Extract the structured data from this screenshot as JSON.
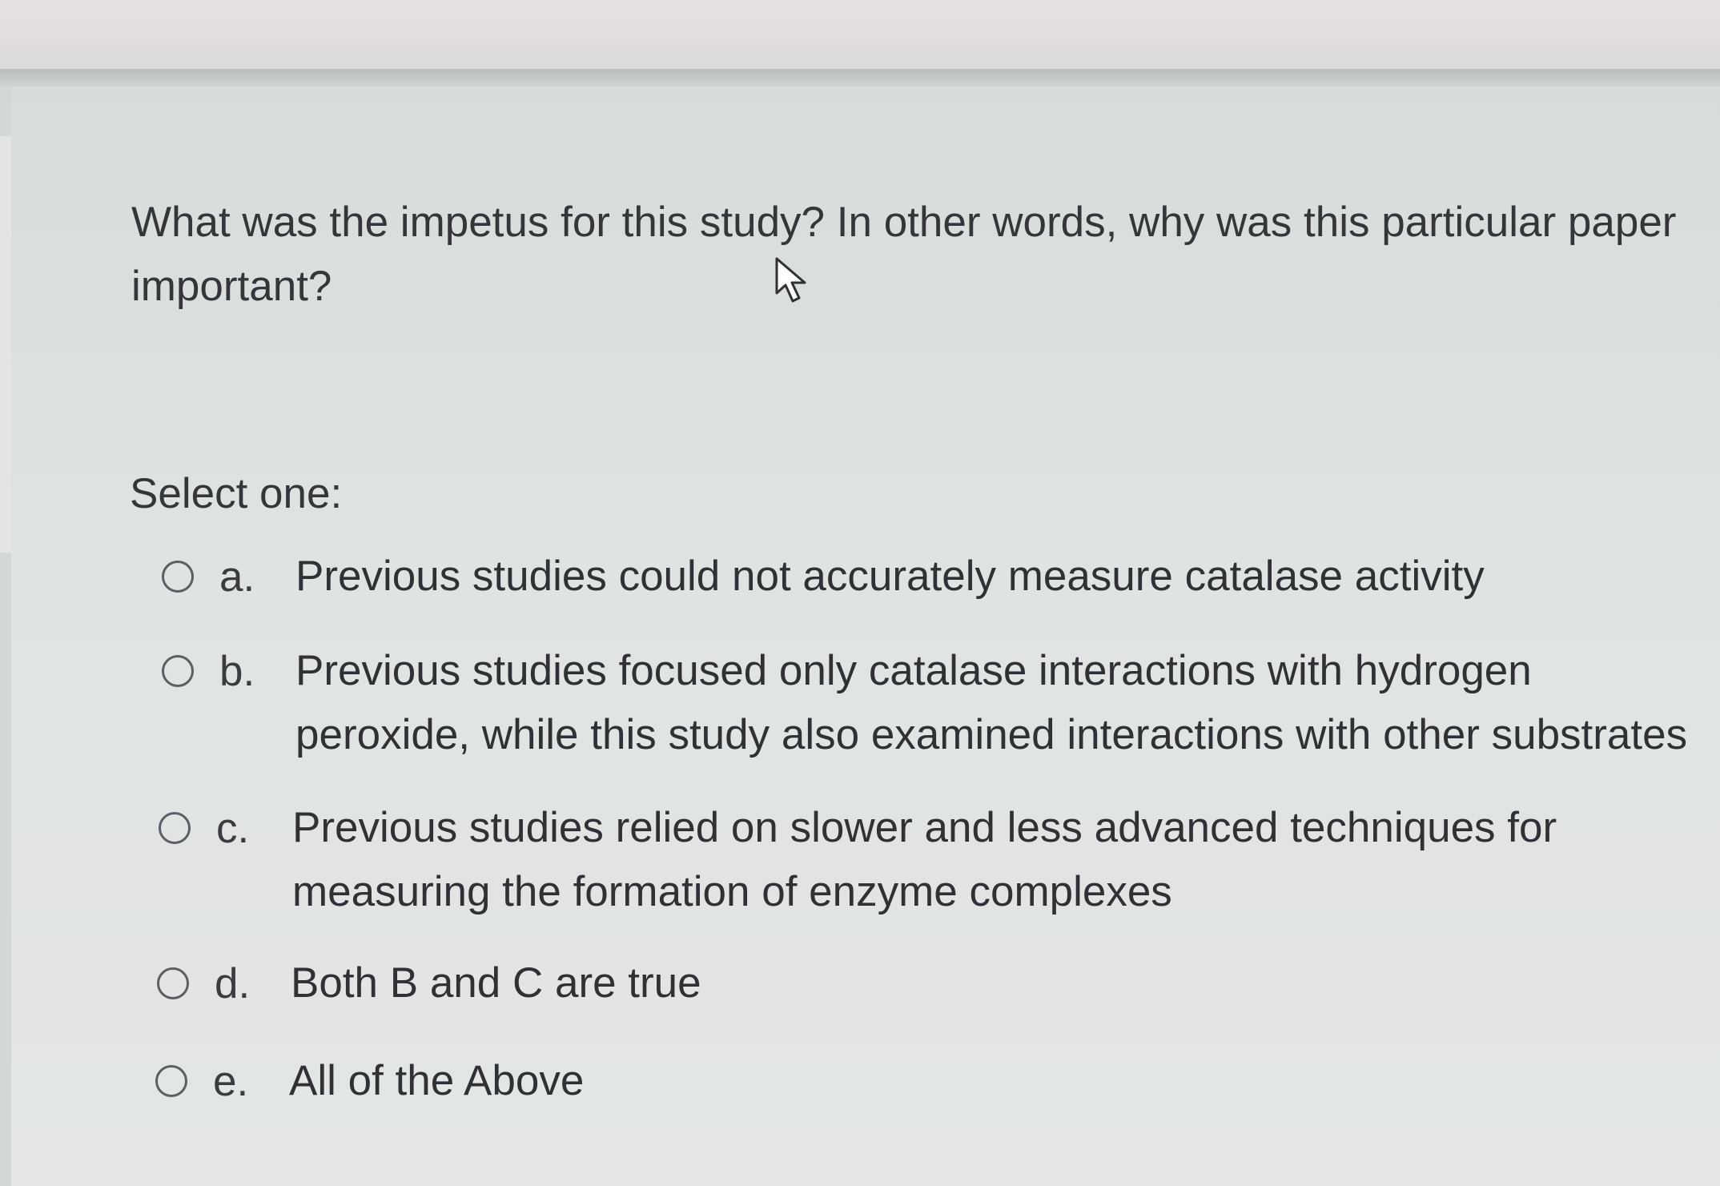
{
  "question": {
    "text": "What was the impetus for this study? In other words, why was this particular paper important?"
  },
  "select_label": "Select one:",
  "answers": [
    {
      "letter": "a.",
      "text": "Previous studies could not accurately measure catalase activity"
    },
    {
      "letter": "b.",
      "text": "Previous studies focused only catalase interactions with hydrogen peroxide, while this study also examined interactions with other substrates"
    },
    {
      "letter": "c.",
      "text": "Previous studies relied on slower and less advanced techniques for measuring the formation of enzyme complexes"
    },
    {
      "letter": "d.",
      "text": "Both B and C are true"
    },
    {
      "letter": "e.",
      "text": "All of the Above"
    }
  ],
  "icons": {
    "cursor": "mouse-pointer-icon",
    "radio": "radio-unselected-icon"
  }
}
